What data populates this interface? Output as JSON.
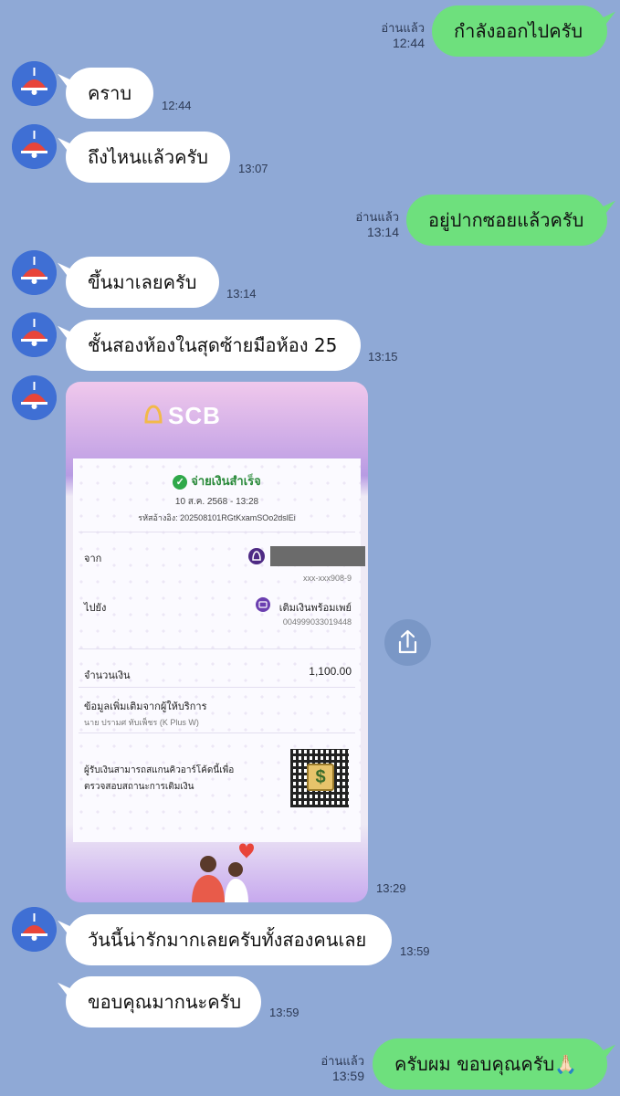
{
  "messages": [
    {
      "text": "กำลังออกไปครับ",
      "read": "อ่านแล้ว",
      "time": "12:44"
    },
    {
      "text": "คราบ",
      "time": "12:44"
    },
    {
      "text": "ถึงไหนแล้วครับ",
      "time": "13:07"
    },
    {
      "text": "อยู่ปากซอยแล้วครับ",
      "read": "อ่านแล้ว",
      "time": "13:14"
    },
    {
      "text": "ขึ้นมาเลยครับ",
      "time": "13:14"
    },
    {
      "text": "ชั้นสองห้องในสุดซ้ายมือห้อง 25",
      "time": "13:15"
    },
    {
      "text": "",
      "time": "13:29"
    },
    {
      "text": "วันนี้น่ารักมากเลยครับทั้งสองคนเลย",
      "time": "13:59"
    },
    {
      "text": "ขอบคุณมากนะครับ",
      "time": "13:59"
    },
    {
      "text": "ครับผม ขอบคุณครับ🙏🏻",
      "read": "อ่านแล้ว",
      "time": "13:59"
    }
  ],
  "receipt": {
    "brand": "SCB",
    "status": "จ่ายเงินสำเร็จ",
    "datetime": "10 ส.ค. 2568 - 13:28",
    "reference": "รหัสอ้างอิง: 202508101RGtKxamSOo2dslEi",
    "from_label": "จาก",
    "from_account": "xxx-xxx908-9",
    "to_label": "ไปยัง",
    "to_name": "เติมเงินพร้อมเพย์",
    "to_account": "004999033019448",
    "amount_label": "จำนวนเงิน",
    "amount": "1,100.00",
    "extra_label": "ข้อมูลเพิ่มเติมจากผู้ให้บริการ",
    "extra_value": "นาย ปรามศ ทับเพ็ชร (K Plus W)",
    "qr_note_1": "ผู้รับเงินสามารถสแกนคิวอาร์โค้ดนี้เพื่อ",
    "qr_note_2": "ตรวจสอบสถานะการเติมเงิน"
  },
  "colors": {
    "background": "#8fa9d6",
    "outgoing_bubble": "#6ee07d",
    "incoming_bubble": "#ffffff",
    "avatar": "#3f6fd4",
    "avatar_lamp": "#e8453a"
  },
  "icons": {
    "avatar": "red-lamp-icon",
    "share": "share-icon",
    "success": "check-circle-icon"
  }
}
